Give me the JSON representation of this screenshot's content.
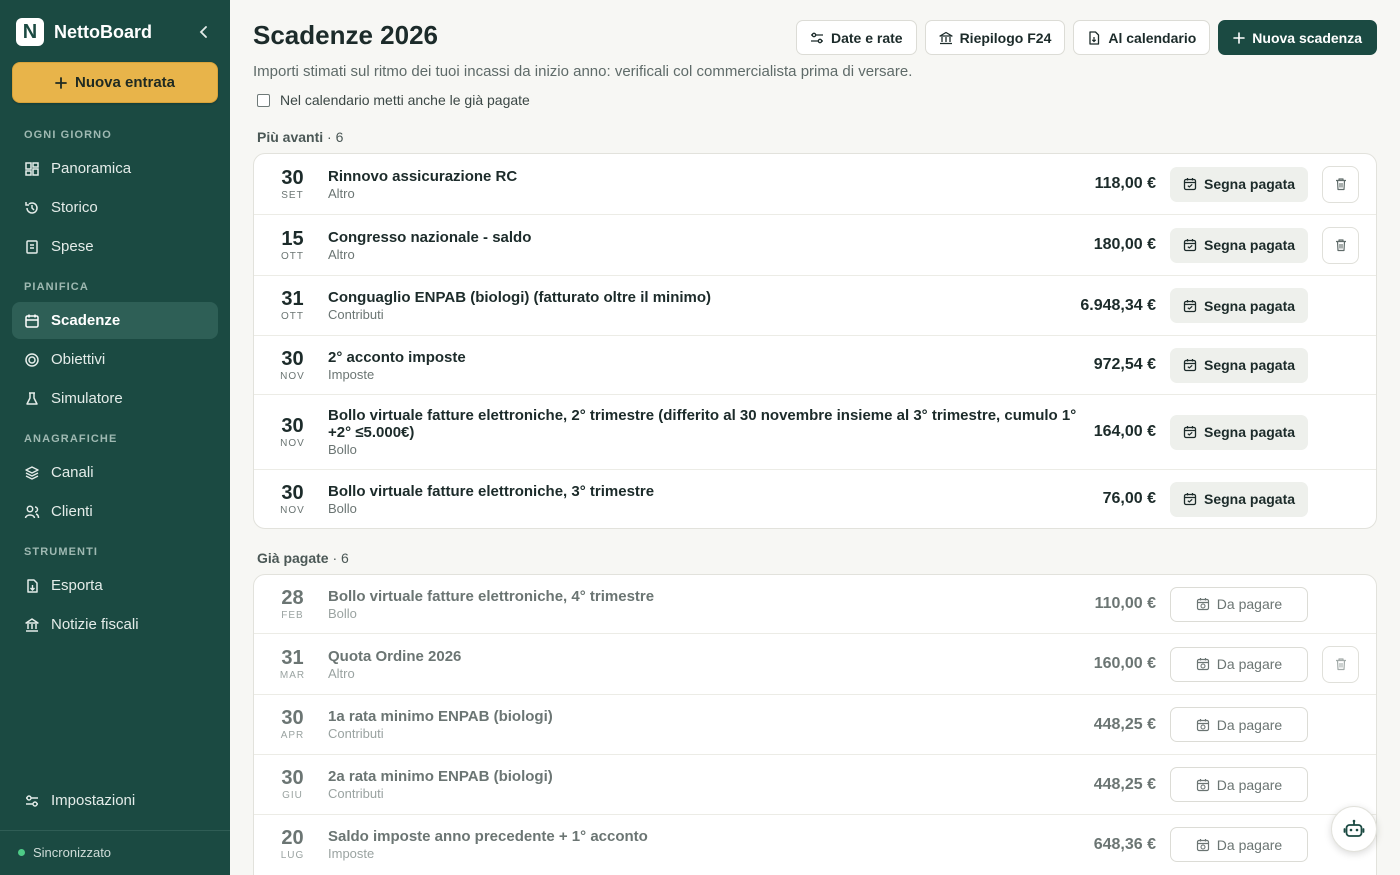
{
  "app": {
    "name": "NettoBoard",
    "logo_letter": "N",
    "new_entry_label": "Nuova entrata",
    "sync_status": "Sincronizzato"
  },
  "sidebar": {
    "sections": [
      {
        "label": "OGNI GIORNO",
        "items": [
          {
            "label": "Panoramica",
            "icon": "dashboard-icon"
          },
          {
            "label": "Storico",
            "icon": "history-icon"
          },
          {
            "label": "Spese",
            "icon": "receipt-icon"
          }
        ]
      },
      {
        "label": "PIANIFICA",
        "items": [
          {
            "label": "Scadenze",
            "icon": "calendar-icon",
            "active": true
          },
          {
            "label": "Obiettivi",
            "icon": "target-icon"
          },
          {
            "label": "Simulatore",
            "icon": "flask-icon"
          }
        ]
      },
      {
        "label": "ANAGRAFICHE",
        "items": [
          {
            "label": "Canali",
            "icon": "layers-icon"
          },
          {
            "label": "Clienti",
            "icon": "users-icon"
          }
        ]
      },
      {
        "label": "STRUMENTI",
        "items": [
          {
            "label": "Esporta",
            "icon": "export-icon"
          },
          {
            "label": "Notizie fiscali",
            "icon": "building-icon"
          }
        ]
      }
    ],
    "settings_label": "Impostazioni"
  },
  "header": {
    "title": "Scadenze 2026",
    "subtitle": "Importi stimati sul ritmo dei tuoi incassi da inizio anno: verificali col commercialista prima di versare.",
    "checkbox_label": "Nel calendario metti anche le già pagate",
    "checkbox_checked": false,
    "buttons": {
      "dates": "Date e rate",
      "f24": "Riepilogo F24",
      "calendar": "Al calendario",
      "new": "Nuova scadenza"
    }
  },
  "upcoming": {
    "label": "Più avanti",
    "count": "· 6",
    "action_label": "Segna pagata",
    "rows": [
      {
        "day": "30",
        "month": "SET",
        "title": "Rinnovo assicurazione RC",
        "category": "Altro",
        "amount": "118,00 €",
        "deletable": true
      },
      {
        "day": "15",
        "month": "OTT",
        "title": "Congresso nazionale - saldo",
        "category": "Altro",
        "amount": "180,00 €",
        "deletable": true
      },
      {
        "day": "31",
        "month": "OTT",
        "title": "Conguaglio ENPAB (biologi) (fatturato oltre il minimo)",
        "category": "Contributi",
        "amount": "6.948,34 €",
        "deletable": false
      },
      {
        "day": "30",
        "month": "NOV",
        "title": "2° acconto imposte",
        "category": "Imposte",
        "amount": "972,54 €",
        "deletable": false
      },
      {
        "day": "30",
        "month": "NOV",
        "title": "Bollo virtuale fatture elettroniche, 2° trimestre (differito al 30 novembre insieme al 3° trimestre, cumulo 1°+2° ≤5.000€)",
        "category": "Bollo",
        "amount": "164,00 €",
        "deletable": false
      },
      {
        "day": "30",
        "month": "NOV",
        "title": "Bollo virtuale fatture elettroniche, 3° trimestre",
        "category": "Bollo",
        "amount": "76,00 €",
        "deletable": false
      }
    ]
  },
  "paid": {
    "label": "Già pagate",
    "count": "· 6",
    "action_label": "Da pagare",
    "rows": [
      {
        "day": "28",
        "month": "FEB",
        "title": "Bollo virtuale fatture elettroniche, 4° trimestre",
        "category": "Bollo",
        "amount": "110,00 €",
        "deletable": false
      },
      {
        "day": "31",
        "month": "MAR",
        "title": "Quota Ordine 2026",
        "category": "Altro",
        "amount": "160,00 €",
        "deletable": true
      },
      {
        "day": "30",
        "month": "APR",
        "title": "1a rata minimo ENPAB (biologi)",
        "category": "Contributi",
        "amount": "448,25 €",
        "deletable": false
      },
      {
        "day": "30",
        "month": "GIU",
        "title": "2a rata minimo ENPAB (biologi)",
        "category": "Contributi",
        "amount": "448,25 €",
        "deletable": false
      },
      {
        "day": "20",
        "month": "LUG",
        "title": "Saldo imposte anno precedente + 1° acconto",
        "category": "Imposte",
        "amount": "648,36 €",
        "deletable": false
      }
    ]
  },
  "colors": {
    "sidebar_bg": "#1b4a42",
    "accent": "#e8b44a",
    "primary": "#1b4a42",
    "sync_dot": "#4ecb87"
  }
}
